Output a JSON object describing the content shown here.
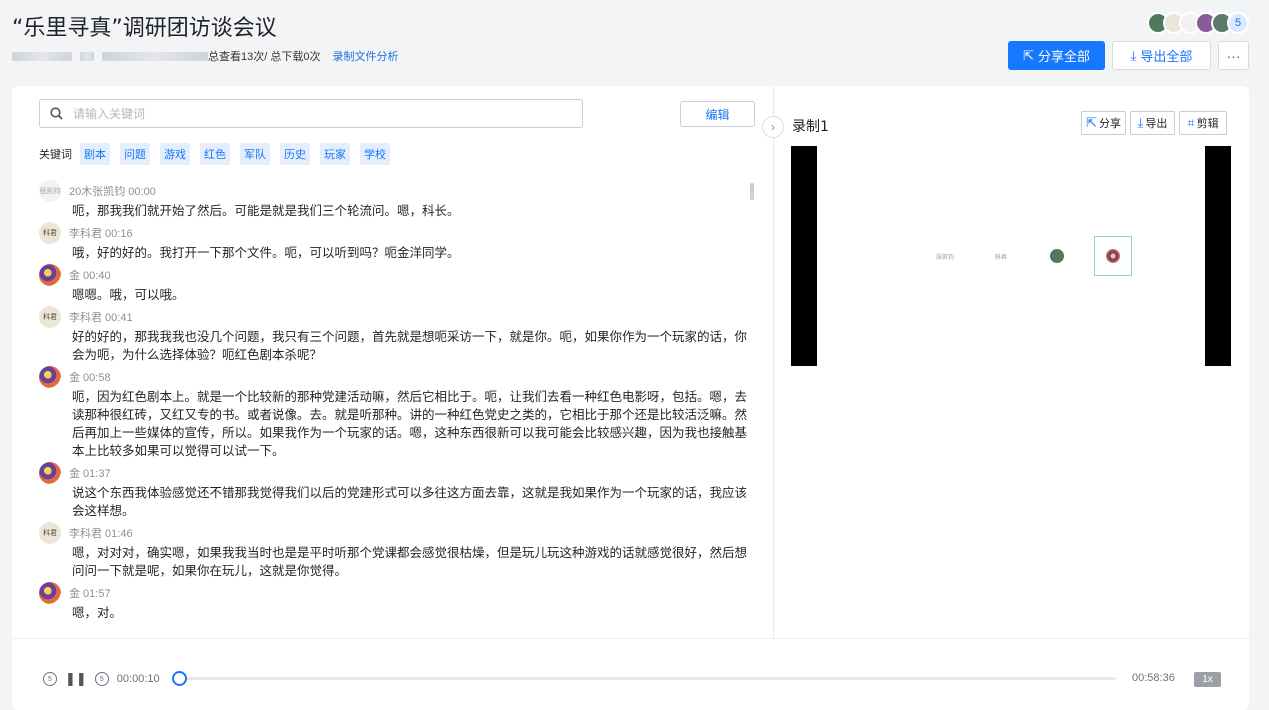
{
  "header": {
    "title": "“乐里寻真”调研团访谈会议",
    "stats": "总查看13次/ 总下载0次",
    "analysis_link": "录制文件分析",
    "participants_count": "5",
    "share_all": "分享全部",
    "export_all": "导出全部",
    "more": "···"
  },
  "left": {
    "search_placeholder": "请输入关键词",
    "edit_label": "编辑",
    "keywords_label": "关键词",
    "keywords": [
      "剧本",
      "问题",
      "游戏",
      "红色",
      "军队",
      "历史",
      "玩家",
      "学校"
    ],
    "entries": [
      {
        "speaker": "20木张凯钧 00:00",
        "avatar_text": "张凯钧",
        "text": "呃，那我我们就开始了然后。可能是就是我们三个轮流问。嗯，科长。"
      },
      {
        "speaker": "李科君 00:16",
        "avatar_text": "科君",
        "text": "哦，好的好的。我打开一下那个文件。呃，可以听到吗？呃金洋同学。"
      },
      {
        "speaker": "金 00:40",
        "avatar_text": "",
        "text": "嗯嗯。哦，可以哦。"
      },
      {
        "speaker": "李科君 00:41",
        "avatar_text": "科君",
        "text": "好的好的，那我我我也没几个问题，我只有三个问题，首先就是想呃采访一下，就是你。呃，如果你作为一个玩家的话，你会为呃，为什么选择体验？呃红色剧本杀呢？"
      },
      {
        "speaker": "金 00:58",
        "avatar_text": "",
        "text": "呃，因为红色剧本上。就是一个比较新的那种党建活动嘛，然后它相比于。呃，让我们去看一种红色电影呀，包括。嗯，去读那种很红砖，又红又专的书。或者说像。去。就是听那种。讲的一种红色党史之类的，它相比于那个还是比较活泛嘛。然后再加上一些媒体的宣传，所以。如果我作为一个玩家的话。嗯，这种东西很新可以我可能会比较感兴趣，因为我也接触基本上比较多如果可以觉得可以试一下。"
      },
      {
        "speaker": "金 01:37",
        "avatar_text": "",
        "text": "说这个东西我体验感觉还不错那我觉得我们以后的党建形式可以多往这方面去靠，这就是我如果作为一个玩家的话，我应该会这样想。"
      },
      {
        "speaker": "李科君 01:46",
        "avatar_text": "科君",
        "text": "嗯，对对对，确实嗯，如果我我当时也是是平时听那个党课都会感觉很枯燥，但是玩儿玩这种游戏的话就感觉很好，然后想问问一下就是呢，如果你在玩儿，这就是你觉得。"
      },
      {
        "speaker": "金 01:57",
        "avatar_text": "",
        "text": "嗯，对。"
      }
    ]
  },
  "right": {
    "recording_title": "录制1",
    "share": "分享",
    "export": "导出",
    "clip": "剪辑",
    "thumb_labels": [
      "张凯钧",
      "科君",
      "",
      ""
    ]
  },
  "player": {
    "rewind": "5",
    "forward": "5",
    "current_time": "00:00:10",
    "duration": "00:58:36",
    "speed": "1x",
    "progress_fraction": 0.003
  }
}
